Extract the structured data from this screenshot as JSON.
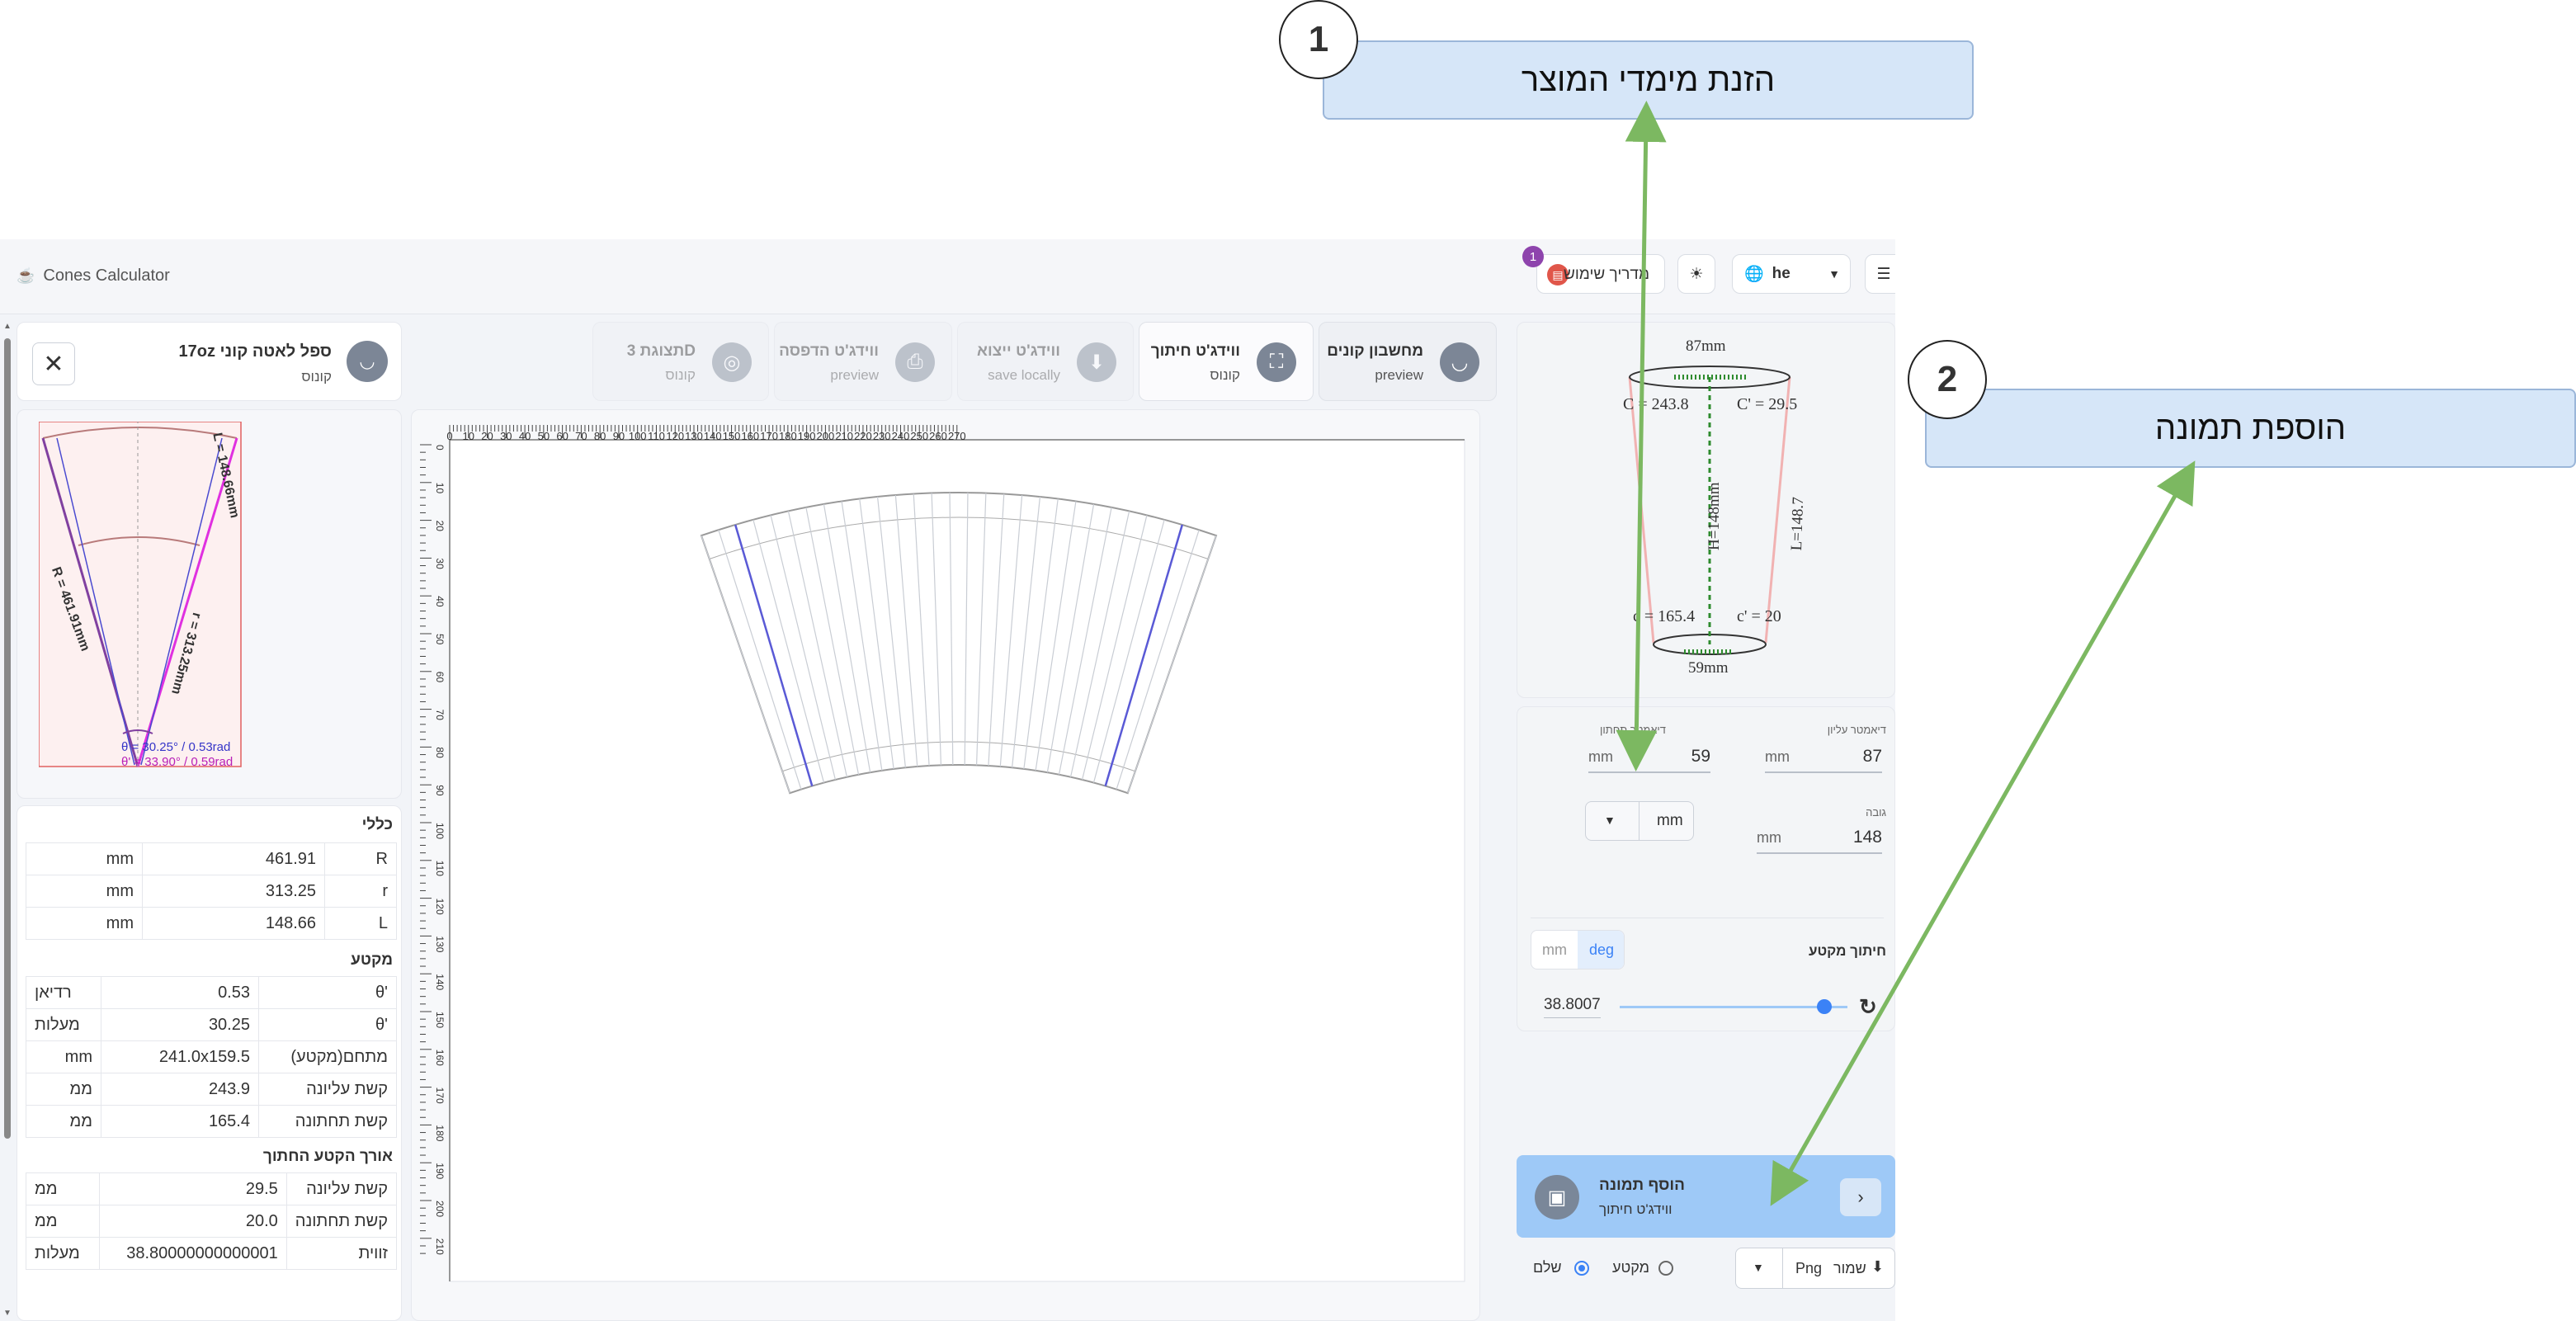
{
  "callouts": [
    {
      "number": "1",
      "label": "הזנת מימדי המוצר"
    },
    {
      "number": "2",
      "label": "הוספת תמונה"
    }
  ],
  "app": {
    "title": "Cones Calculator",
    "guide_label": "מדריך שימוש",
    "guide_badge": "1",
    "language": "he"
  },
  "tabs": [
    {
      "title": "מחשבון קונים",
      "subtitle": "preview"
    },
    {
      "title": "ווידג'ט חיתוך",
      "subtitle": "קונוס"
    },
    {
      "title": "ווידג'ט ייצוא",
      "subtitle": "save locally"
    },
    {
      "title": "ווידג'ט הדפסה",
      "subtitle": "preview"
    },
    {
      "title": "תצוגת 3D",
      "subtitle": "קונוס"
    }
  ],
  "product": {
    "name": "17oz ספל לאטה קוני",
    "type": "קונוס"
  },
  "mini_preview": {
    "L_label": "L = 148.66mm",
    "R_label": "R = 461.91mm",
    "r_label": "r = 313.25mm",
    "theta_label": "θ = 30.25° / 0.53rad",
    "theta2_label": "θ' = 33.90° / 0.59rad"
  },
  "table_general": {
    "title": "כללי",
    "rows": [
      {
        "key": "R",
        "value": "461.91",
        "unit": "mm"
      },
      {
        "key": "r",
        "value": "313.25",
        "unit": "mm"
      },
      {
        "key": "L",
        "value": "148.66",
        "unit": "mm"
      }
    ]
  },
  "table_sector": {
    "title": "מקטע",
    "rows": [
      {
        "key": "θ'",
        "value": "0.53",
        "unit": "רדיאן"
      },
      {
        "key": "θ'",
        "value": "30.25",
        "unit": "מעלות"
      },
      {
        "key": "מתחם(מקטע)",
        "value": "241.0x159.5",
        "unit": "mm"
      },
      {
        "key": "קשת עליונה",
        "value": "243.9",
        "unit": "ממ"
      },
      {
        "key": "קשת תחתונה",
        "value": "165.4",
        "unit": "ממ"
      }
    ]
  },
  "table_cut": {
    "title": "אורך הקטע החתוך",
    "rows": [
      {
        "key": "קשת עליונה",
        "value": "29.5",
        "unit": "ממ"
      },
      {
        "key": "קשת תחתונה",
        "value": "20.0",
        "unit": "ממ"
      },
      {
        "key": "זווית",
        "value": "38.80000000000001",
        "unit": "מעלות"
      }
    ]
  },
  "ruler": {
    "top_ticks": [
      "0",
      "10",
      "20",
      "30",
      "40",
      "50",
      "60",
      "70",
      "80",
      "90",
      "100",
      "110",
      "120",
      "130",
      "140",
      "150",
      "160",
      "170",
      "180",
      "190",
      "200",
      "210",
      "220",
      "230",
      "240",
      "250",
      "260",
      "270"
    ],
    "left_ticks": [
      "0",
      "10",
      "20",
      "30",
      "40",
      "50",
      "60",
      "70",
      "80",
      "90",
      "100",
      "110",
      "120",
      "130",
      "140",
      "150",
      "160",
      "170",
      "180",
      "190",
      "200",
      "210"
    ]
  },
  "cup_diagram": {
    "top_diameter": "87mm",
    "bottom_diameter": "59mm",
    "C_label": "C = 243.8",
    "C2_label": "C' = 29.5",
    "H_label": "H=148mm",
    "L_label": "L=148.7",
    "c_label": "c = 165.4",
    "c2_label": "c' = 20"
  },
  "inputs": {
    "top_diameter": {
      "label": "דיאמטר עליון",
      "value": "87",
      "unit": "mm"
    },
    "bottom_diameter": {
      "label": "דיאמטר תחתון",
      "value": "59",
      "unit": "mm"
    },
    "height": {
      "label": "גובה",
      "value": "148",
      "unit": "mm"
    },
    "unit_select": "mm"
  },
  "sector_cut": {
    "label": "חיתוך מקטע",
    "unit_mm": "mm",
    "unit_deg": "deg",
    "value": "38.8007",
    "slider_fraction": 0.9
  },
  "add_image": {
    "title": "הוסף תמונה",
    "subtitle": "ווידג'ט חיתוך"
  },
  "export": {
    "save_label": "שמור",
    "format": "Png",
    "option_full": "שלם",
    "option_sector": "מקטע"
  },
  "colors": {
    "accent": "#3b82f6",
    "callout_bg": "#d6e6f8",
    "arrow": "#7cb861",
    "add_image_bg": "#9ec9f7"
  }
}
